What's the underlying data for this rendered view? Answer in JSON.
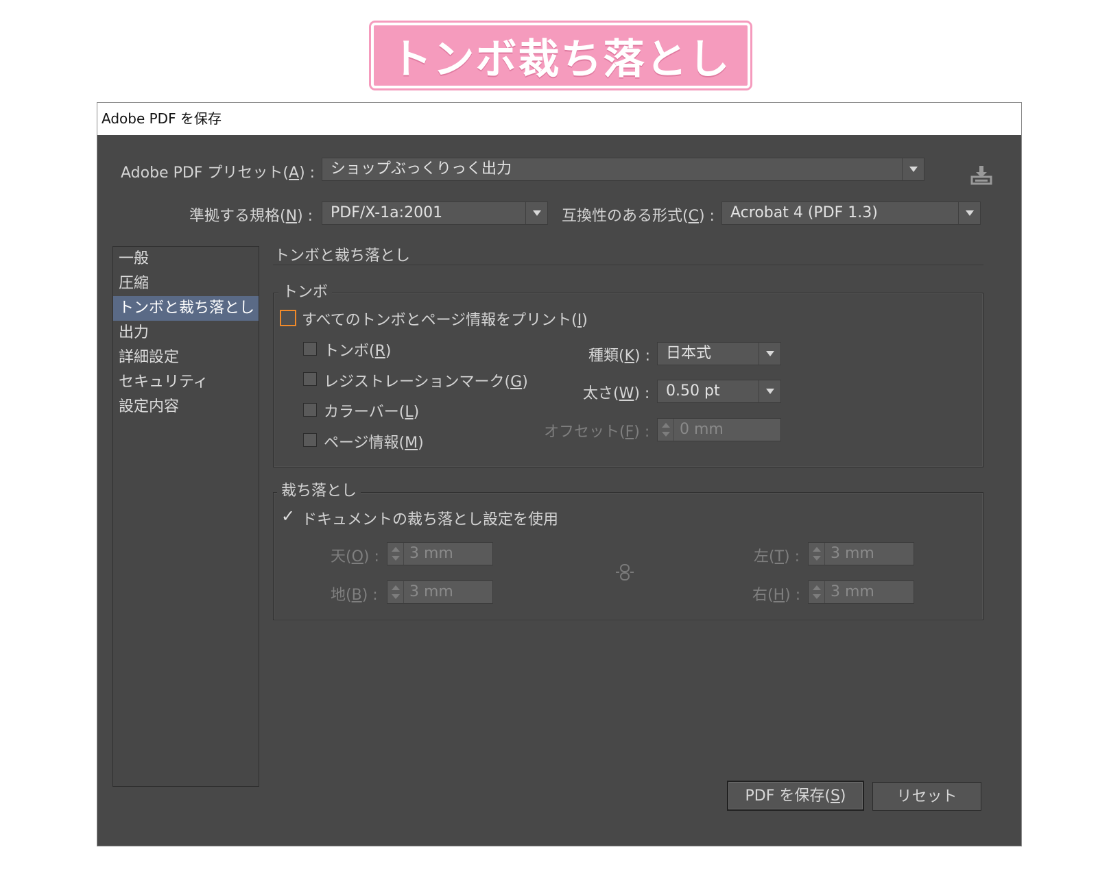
{
  "banner": {
    "title": "トンボ裁ち落とし"
  },
  "dialog": {
    "title": "Adobe PDF を保存"
  },
  "preset": {
    "label": "Adobe  PDF プリセット(",
    "key": "A",
    "label_end": ") :",
    "value": "ショップぶっくりっく出力"
  },
  "standard": {
    "label": "準拠する規格(",
    "key": "N",
    "label_end": ") :",
    "value": "PDF/X-1a:2001"
  },
  "compat": {
    "label": "互換性のある形式(",
    "key": "C",
    "label_end": ") :",
    "value": "Acrobat 4 (PDF 1.3)"
  },
  "nav": {
    "items": [
      {
        "label": "一般"
      },
      {
        "label": "圧縮"
      },
      {
        "label": "トンボと裁ち落とし"
      },
      {
        "label": "出力"
      },
      {
        "label": "詳細設定"
      },
      {
        "label": "セキュリティ"
      },
      {
        "label": "設定内容"
      }
    ],
    "selected": "トンボと裁ち落とし"
  },
  "section": {
    "title": "トンボと裁ち落とし"
  },
  "marks": {
    "group_title": "トンボ",
    "all_marks": {
      "label": "すべてのトンボとページ情報をプリント(",
      "key": "I",
      "label_end": ")"
    },
    "crop": {
      "label": "トンボ(",
      "key": "R",
      "label_end": ")"
    },
    "registration": {
      "label": "レジストレーションマーク(",
      "key": "G",
      "label_end": ")"
    },
    "color_bar": {
      "label": "カラーバー(",
      "key": "L",
      "label_end": ")"
    },
    "page_info": {
      "label": "ページ情報(",
      "key": "M",
      "label_end": ")"
    },
    "type": {
      "label": "種類(",
      "key": "K",
      "label_end": ") :",
      "value": "日本式"
    },
    "weight": {
      "label": "太さ(",
      "key": "W",
      "label_end": ") :",
      "value": "0.50 pt"
    },
    "offset": {
      "label": "オフセット(",
      "key": "F",
      "label_end": ") :",
      "value": "0 mm"
    }
  },
  "bleed": {
    "group_title": "裁ち落とし",
    "use_doc": {
      "label": "ドキュメントの裁ち落とし設定を使用",
      "checkmark": "✓"
    },
    "top": {
      "label": "天(",
      "key": "O",
      "label_end": ") :",
      "value": "3 mm"
    },
    "bottom": {
      "label": "地(",
      "key": "B",
      "label_end": ") :",
      "value": "3 mm"
    },
    "left": {
      "label": "左(",
      "key": "T",
      "label_end": ") :",
      "value": "3 mm"
    },
    "right": {
      "label": "右(",
      "key": "H",
      "label_end": ") :",
      "value": "3 mm"
    }
  },
  "buttons": {
    "save": {
      "label": "PDF を保存(",
      "key": "S",
      "label_end": ")"
    },
    "reset": {
      "label": "リセット"
    }
  },
  "colors": {
    "banner_pink": "#f59bbd",
    "dialog_bg": "#484848",
    "selected_nav": "#5a6a86",
    "checkbox_highlight": "#f08a2a"
  },
  "icons": [
    "save-preset-icon",
    "chevron-down-icon",
    "spinner-arrows-icon",
    "link-chain-icon",
    "checkmark-icon"
  ]
}
